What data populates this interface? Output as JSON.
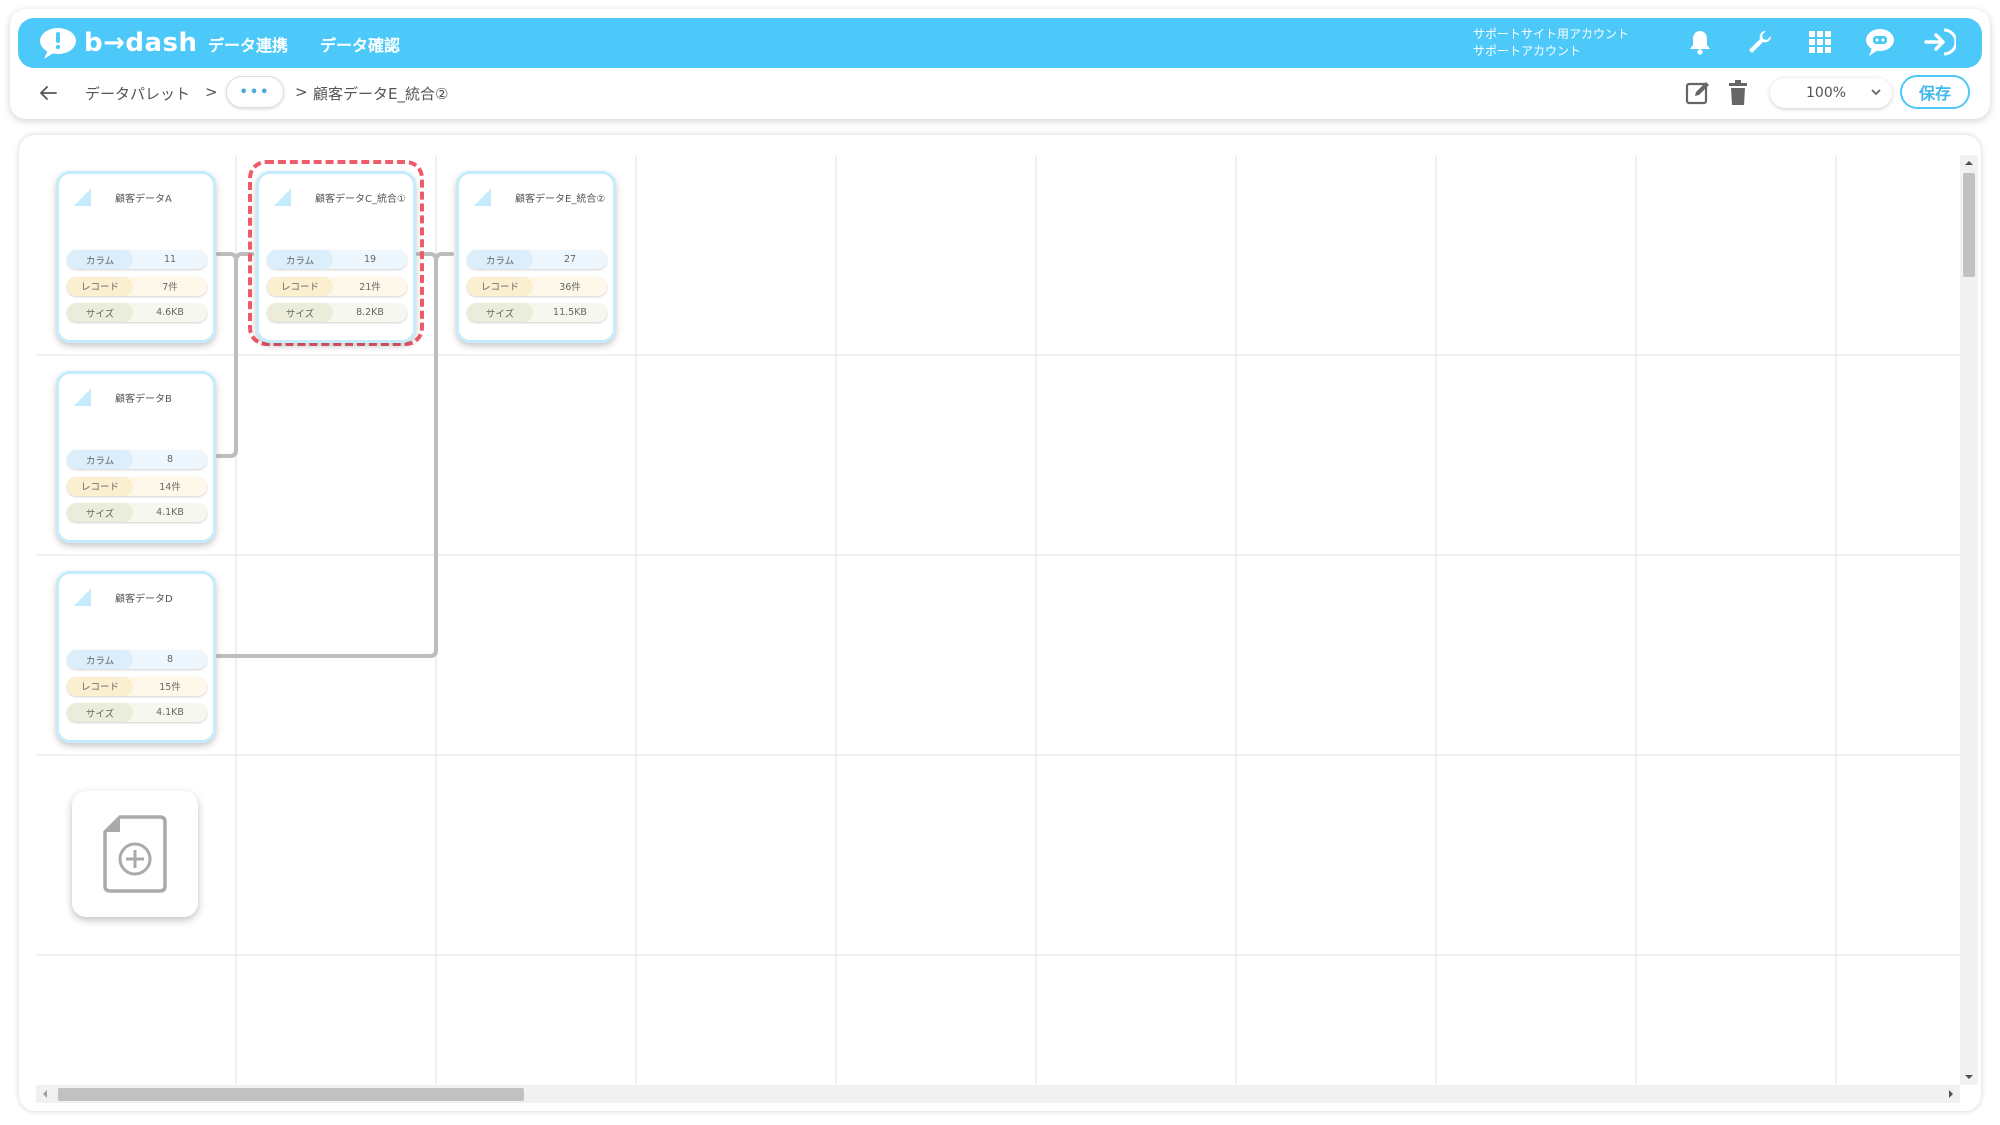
{
  "header": {
    "logo_text": "b→dash",
    "nav": [
      "データ連携",
      "データ確認"
    ],
    "account_line1": "サポートサイト用アカウント",
    "account_line2": "サポートアカウント",
    "icons": [
      "bell-icon",
      "wrench-icon",
      "grid-icon",
      "chat-robot-icon",
      "logout-icon"
    ],
    "accent_color": "#4cc9f8"
  },
  "breadcrumb": {
    "root": "データパレット",
    "sep": ">",
    "ellipsis": "•••",
    "current": "顧客データE_統合②"
  },
  "toolbar": {
    "zoom": "100%",
    "save_label": "保存",
    "icons": [
      "edit-icon",
      "trash-icon"
    ]
  },
  "cards": [
    {
      "title": "顧客データA",
      "column_label": "カラム",
      "column": "11",
      "record_label": "レコード",
      "record": "7件",
      "size_label": "サイズ",
      "size": "4.6KB"
    },
    {
      "title": "顧客データC_統合①",
      "column_label": "カラム",
      "column": "19",
      "record_label": "レコード",
      "record": "21件",
      "size_label": "サイズ",
      "size": "8.2KB"
    },
    {
      "title": "顧客データE_統合②",
      "column_label": "カラム",
      "column": "27",
      "record_label": "レコード",
      "record": "36件",
      "size_label": "サイズ",
      "size": "11.5KB"
    },
    {
      "title": "顧客データB",
      "column_label": "カラム",
      "column": "8",
      "record_label": "レコード",
      "record": "14件",
      "size_label": "サイズ",
      "size": "4.1KB"
    },
    {
      "title": "顧客データD",
      "column_label": "カラム",
      "column": "8",
      "record_label": "レコード",
      "record": "15件",
      "size_label": "サイズ",
      "size": "4.1KB"
    }
  ],
  "selected_color": "#ee5c6c"
}
